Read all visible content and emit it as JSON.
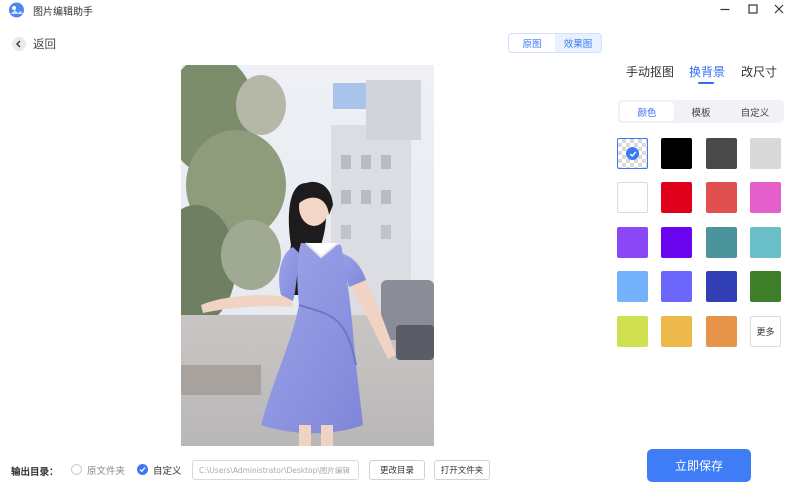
{
  "app": {
    "title": "图片编辑助手"
  },
  "nav": {
    "back_label": "返回"
  },
  "view_toggle": {
    "options": [
      "原图",
      "效果图"
    ],
    "active": 1
  },
  "panel": {
    "tabs": [
      "手动抠图",
      "换背景",
      "改尺寸"
    ],
    "active_tab": 1,
    "subtabs": [
      "颜色",
      "模板",
      "自定义"
    ],
    "active_subtab": 0,
    "swatches": [
      {
        "name": "transparent",
        "color": "transparent",
        "selected": true
      },
      {
        "name": "black",
        "color": "#000000"
      },
      {
        "name": "dark-gray",
        "color": "#4a4a4a"
      },
      {
        "name": "light-gray",
        "color": "#d9d9d9"
      },
      {
        "name": "white",
        "color": "#ffffff"
      },
      {
        "name": "red",
        "color": "#e0001b"
      },
      {
        "name": "coral",
        "color": "#e05050"
      },
      {
        "name": "pink",
        "color": "#e45fcb"
      },
      {
        "name": "violet",
        "color": "#8b47f5"
      },
      {
        "name": "purple",
        "color": "#6a05f0"
      },
      {
        "name": "teal",
        "color": "#4c949c"
      },
      {
        "name": "cyan",
        "color": "#6bbfc8"
      },
      {
        "name": "sky-blue",
        "color": "#74b2fb"
      },
      {
        "name": "periwinkle",
        "color": "#6d66fb"
      },
      {
        "name": "royal-blue",
        "color": "#3040b4"
      },
      {
        "name": "green",
        "color": "#3f7e2a"
      },
      {
        "name": "lime",
        "color": "#cfe050"
      },
      {
        "name": "mustard",
        "color": "#ecb94a"
      },
      {
        "name": "orange",
        "color": "#e7944a"
      }
    ],
    "more_label": "更多"
  },
  "footer": {
    "output_label": "输出目录：",
    "option_original": "原文件夹",
    "option_custom": "自定义",
    "path_value": "C:\\Users\\Administrator\\Desktop\\图片编辑",
    "change_dir_label": "更改目录",
    "open_folder_label": "打开文件夹"
  },
  "save_button": "立即保存",
  "colors": {
    "accent": "#3f7df6"
  }
}
